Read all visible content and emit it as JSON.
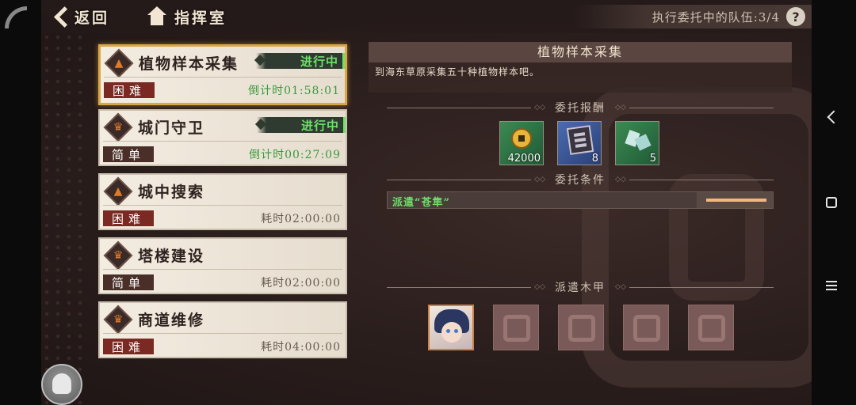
{
  "topbar": {
    "back_label": "返回",
    "home_label": "指挥室",
    "team_status": "执行委托中的队伍:3/4",
    "help_glyph": "?"
  },
  "quests": [
    {
      "name": "植物样本采集",
      "difficulty": "困难",
      "difficulty_level": "hard",
      "status": "进行中",
      "time": "倒计时01:58:01",
      "running": true,
      "emblem": "flame-icon",
      "selected": true
    },
    {
      "name": "城门守卫",
      "difficulty": "简单",
      "difficulty_level": "easy",
      "status": "进行中",
      "time": "倒计时00:27:09",
      "running": true,
      "emblem": "crown-icon",
      "selected": false
    },
    {
      "name": "城中搜索",
      "difficulty": "困难",
      "difficulty_level": "hard",
      "status": "",
      "time": "耗时02:00:00",
      "running": false,
      "emblem": "flame-icon",
      "selected": false
    },
    {
      "name": "塔楼建设",
      "difficulty": "简单",
      "difficulty_level": "easy",
      "status": "",
      "time": "耗时02:00:00",
      "running": false,
      "emblem": "crown-icon",
      "selected": false
    },
    {
      "name": "商道维修",
      "difficulty": "困难",
      "difficulty_level": "hard",
      "status": "",
      "time": "耗时04:00:00",
      "running": false,
      "emblem": "crown-icon",
      "selected": false
    }
  ],
  "detail": {
    "title": "植物样本采集",
    "description": "到海东草原采集五十种植物样本吧。",
    "reward_header": "委托报酬",
    "rewards": [
      {
        "icon": "gold-coin-icon",
        "qty": "42000",
        "color": "#2f7a48"
      },
      {
        "icon": "book-icon",
        "qty": "8",
        "color": "#3a56a0"
      },
      {
        "icon": "crystal-icon",
        "qty": "5",
        "color": "#2f7a48"
      }
    ],
    "condition_header": "委托条件",
    "condition_text": "派遣“苍隼”",
    "team_header": "派遣木甲",
    "team_slots": 5
  },
  "colors": {
    "accent_green": "#6fe06a",
    "hard_red": "#7a2a22",
    "selected_gold": "#d9a64a"
  }
}
